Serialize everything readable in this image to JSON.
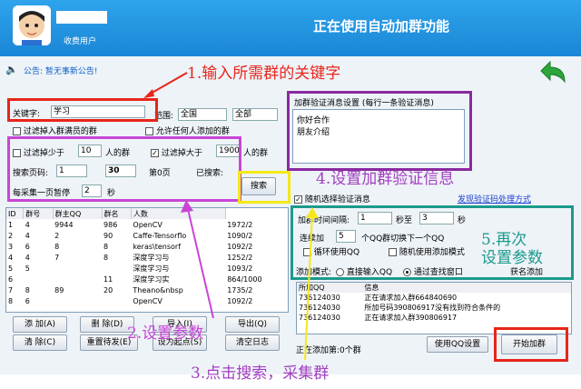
{
  "header": {
    "user_level": "收费用户",
    "mode_title": "正在使用自动加群功能"
  },
  "notice": {
    "text": "公告: 暂无事新公告!"
  },
  "search": {
    "keyword_label": "关键字:",
    "keyword_value": "学习",
    "range_label": "范围:",
    "range_value": "全国",
    "type_value": "全部",
    "opt_full": "过滤掉入群满员的群",
    "opt_allow": "允许任何人添加的群",
    "filter_min_label": "过滤掉少于",
    "filter_min_value": "10",
    "filter_min_unit": "人的群",
    "filter_max_label": "过滤掉大于",
    "filter_max_value": "1900",
    "filter_max_unit": "人的群",
    "page_label": "搜索页码:",
    "page_value": "1",
    "page2_value": "30",
    "page_unit": "第0页",
    "searched_label": "已搜索:",
    "pause_label": "每采集一页暂停",
    "pause_value": "2",
    "pause_unit": "秒",
    "search_button": "搜索"
  },
  "verify": {
    "title": "加群验证消息设置 (每行一条验证消息)",
    "lines": [
      "你好合作",
      "朋友介绍"
    ],
    "random_label": "随机选择验证消息",
    "link": "发现验证码处理方式"
  },
  "interval": {
    "label": "加群时间间隔:",
    "from": "1",
    "to_label": "秒至",
    "to": "3",
    "unit": "秒",
    "cont_label": "连续加",
    "cont_value": "5",
    "cont_unit": "个QQ群切换下一个QQ",
    "loop_label": "循环使用QQ",
    "random_mode_label": "随机使用添加模式",
    "mode_label": "添加模式:",
    "mode_direct": "直接输入QQ",
    "mode_search": "通过查找窗口",
    "check_label": "获名添加"
  },
  "table": {
    "headers": [
      "ID",
      "群号",
      "群主QQ",
      "群名",
      "人数"
    ],
    "rows": [
      [
        "1",
        "4",
        "9944",
        "986",
        "OpenCV",
        "1972/2"
      ],
      [
        "2",
        "4",
        "2",
        "90",
        "Caffe-Tensorflo",
        "1090/2"
      ],
      [
        "3",
        "6",
        "8",
        "8",
        "keras\\tensorf",
        "1092/2"
      ],
      [
        "4",
        "4",
        "7",
        "8",
        "深度学习与",
        "1252/2"
      ],
      [
        "5",
        "5",
        "",
        "",
        "深度学习与",
        "1093/2"
      ],
      [
        "6",
        "",
        "",
        "11",
        "深度学习实",
        "864/1000"
      ],
      [
        "7",
        "8",
        "89",
        "20",
        "Theano&nbsp",
        "1735/2"
      ],
      [
        "8",
        "6",
        "",
        "",
        "OpenCV",
        "1092/2"
      ]
    ]
  },
  "buttons": {
    "add": "添 加(A)",
    "delete": "删 除(D)",
    "import": "导入(I)",
    "export": "导出(Q)",
    "clear": "清 除(C)",
    "reset": "重置待发(E)",
    "set_start": "设为起点(S)",
    "clear_log": "清空日志",
    "qq_settings": "使用QQ设置",
    "start": "开始加群"
  },
  "log": {
    "headers": [
      "所加QQ",
      "信息"
    ],
    "rows": [
      [
        "736124030",
        "正在请求加入群664840690"
      ],
      [
        "736124030",
        "所加号码390806917没有找到符合条件的"
      ],
      [
        "736124030",
        "正在请求加入群390806917"
      ]
    ],
    "status": "正在添加第:0个群"
  },
  "annotations": {
    "a1": "1.输入所需群的关键字",
    "a2": "2.设置参数",
    "a3": "3.点击搜索，采集群",
    "a4": "4.设置加群验证信息",
    "a5": "5.再次\n设置参数"
  },
  "colors": {
    "header": "#1e90e0",
    "red": "#e8251a",
    "purple": "#a23fc0",
    "yellow": "#f4e81a",
    "teal": "#1c9a8c"
  }
}
